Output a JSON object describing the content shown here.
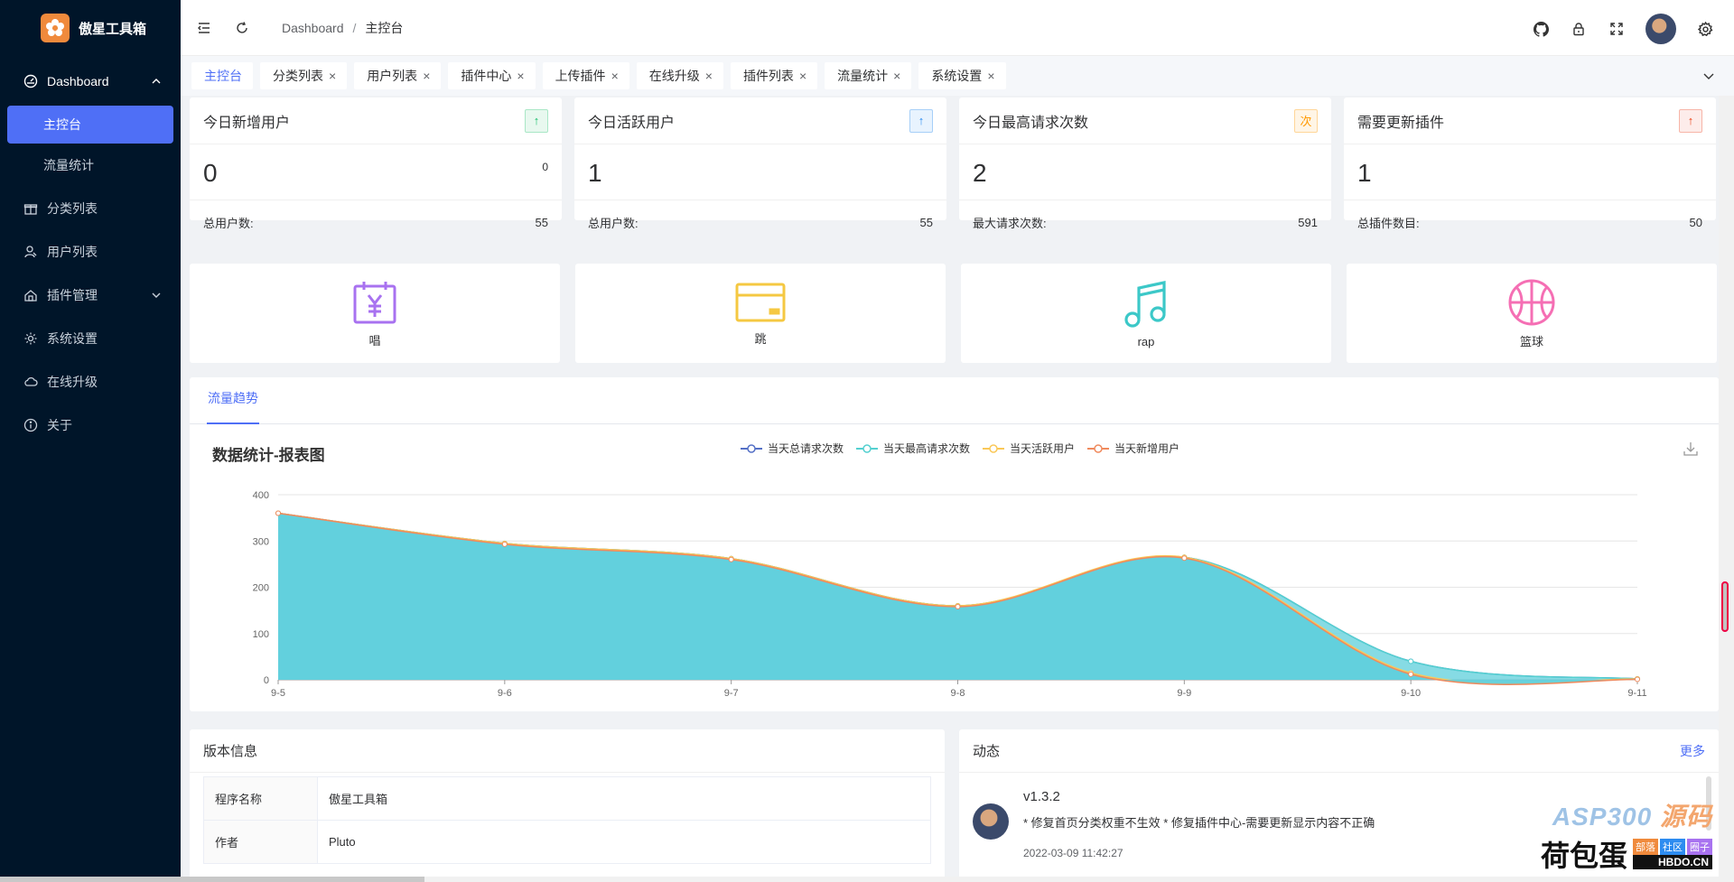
{
  "app": {
    "name": "傲星工具箱"
  },
  "sidebar": {
    "items": [
      {
        "label": "Dashboard",
        "icon": "dashboard-icon"
      },
      {
        "label": "主控台"
      },
      {
        "label": "流量统计"
      },
      {
        "label": "分类列表",
        "icon": "gift-icon"
      },
      {
        "label": "用户列表",
        "icon": "user-icon"
      },
      {
        "label": "插件管理",
        "icon": "plugin-icon"
      },
      {
        "label": "系统设置",
        "icon": "gear-icon"
      },
      {
        "label": "在线升级",
        "icon": "cloud-icon"
      },
      {
        "label": "关于",
        "icon": "info-icon"
      }
    ]
  },
  "header": {
    "breadcrumb": [
      "Dashboard",
      "主控台"
    ],
    "separator": "/"
  },
  "tabs": [
    "主控台",
    "分类列表",
    "用户列表",
    "插件中心",
    "上传插件",
    "在线升级",
    "插件列表",
    "流量统计",
    "系统设置"
  ],
  "stats": [
    {
      "title": "今日新增用户",
      "badge": "↑",
      "badge_color": "#19be6b",
      "value": "0",
      "small": "0",
      "foot_label": "总用户数:",
      "foot_value": "55"
    },
    {
      "title": "今日活跃用户",
      "badge": "↑",
      "badge_color": "#2d8cf0",
      "value": "1",
      "small": "",
      "foot_label": "总用户数:",
      "foot_value": "55"
    },
    {
      "title": "今日最高请求次数",
      "badge": "次",
      "badge_color": "#ff9900",
      "value": "2",
      "small": "",
      "foot_label": "最大请求次数:",
      "foot_value": "591"
    },
    {
      "title": "需要更新插件",
      "badge": "↑",
      "badge_color": "#ed4014",
      "value": "1",
      "small": "",
      "foot_label": "总插件数目:",
      "foot_value": "50"
    }
  ],
  "shortcuts": [
    {
      "label": "唱",
      "icon": "calendar-yen-icon",
      "color": "#a872f0"
    },
    {
      "label": "跳",
      "icon": "card-icon",
      "color": "#f5c842"
    },
    {
      "label": "rap",
      "icon": "music-icon",
      "color": "#3cc8c8"
    },
    {
      "label": "篮球",
      "icon": "basketball-icon",
      "color": "#f56fb4"
    }
  ],
  "chart_tab": "流量趋势",
  "chart_data": {
    "type": "area",
    "title": "数据统计-报表图",
    "categories": [
      "9-5",
      "9-6",
      "9-7",
      "9-8",
      "9-9",
      "9-10",
      "9-11"
    ],
    "ylim": [
      0,
      400
    ],
    "yticks": [
      0,
      100,
      200,
      300,
      400
    ],
    "legend_position": "top",
    "series": [
      {
        "name": "当天总请求次数",
        "color": "#5470c6",
        "values": [
          360,
          295,
          262,
          160,
          265,
          40,
          2
        ]
      },
      {
        "name": "当天最高请求次数",
        "color": "#54d0d0",
        "values": [
          360,
          295,
          262,
          160,
          265,
          40,
          2
        ]
      },
      {
        "name": "当天活跃用户",
        "color": "#fac858",
        "values": [
          360,
          295,
          262,
          160,
          265,
          15,
          2
        ]
      },
      {
        "name": "当天新增用户",
        "color": "#f08a5d",
        "values": [
          360,
          293,
          260,
          158,
          263,
          12,
          1
        ]
      }
    ]
  },
  "version_panel": {
    "title": "版本信息",
    "rows": [
      {
        "key": "程序名称",
        "value": "傲星工具箱"
      },
      {
        "key": "作者",
        "value": "Pluto"
      }
    ]
  },
  "news_panel": {
    "title": "动态",
    "more": "更多",
    "items": [
      {
        "version": "v1.3.2",
        "desc": "* 修复首页分类权重不生效 * 修复插件中心-需要更新显示内容不正确",
        "date": "2022-03-09 11:42:27"
      }
    ]
  },
  "watermark": {
    "brand": "ASP300",
    "brand2": "源码",
    "cn": "荷包蛋",
    "tags": [
      "部落",
      "社区",
      "圈子"
    ],
    "url": "HBDO.CN"
  }
}
